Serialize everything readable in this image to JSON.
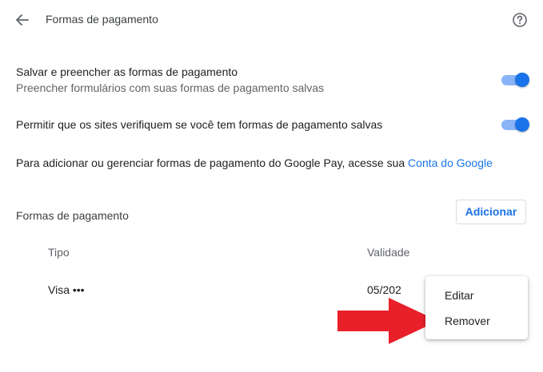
{
  "header": {
    "title": "Formas de pagamento",
    "back_icon": "arrow-back-icon",
    "help_icon": "help-circle-icon"
  },
  "settings": {
    "save_fill": {
      "label": "Salvar e preencher as formas de pagamento",
      "sublabel": "Preencher formulários com suas formas de pagamento salvas",
      "enabled": true
    },
    "allow_sites": {
      "label": "Permitir que os sites verifiquem se você tem formas de pagamento salvas",
      "enabled": true
    },
    "google_pay": {
      "text": "Para adicionar ou gerenciar formas de pagamento do Google Pay, acesse sua ",
      "link": "Conta do Google"
    }
  },
  "payments": {
    "section_title": "Formas de pagamento",
    "add_label": "Adicionar",
    "columns": {
      "type": "Tipo",
      "validity": "Validade"
    },
    "rows": [
      {
        "type": "Visa •••",
        "validity": "05/202"
      }
    ]
  },
  "context_menu": {
    "items": [
      {
        "label": "Editar"
      },
      {
        "label": "Remover"
      }
    ]
  },
  "colors": {
    "accent": "#1a73e8",
    "toggle_track": "#8ab4f8",
    "arrow": "#e8202a"
  }
}
